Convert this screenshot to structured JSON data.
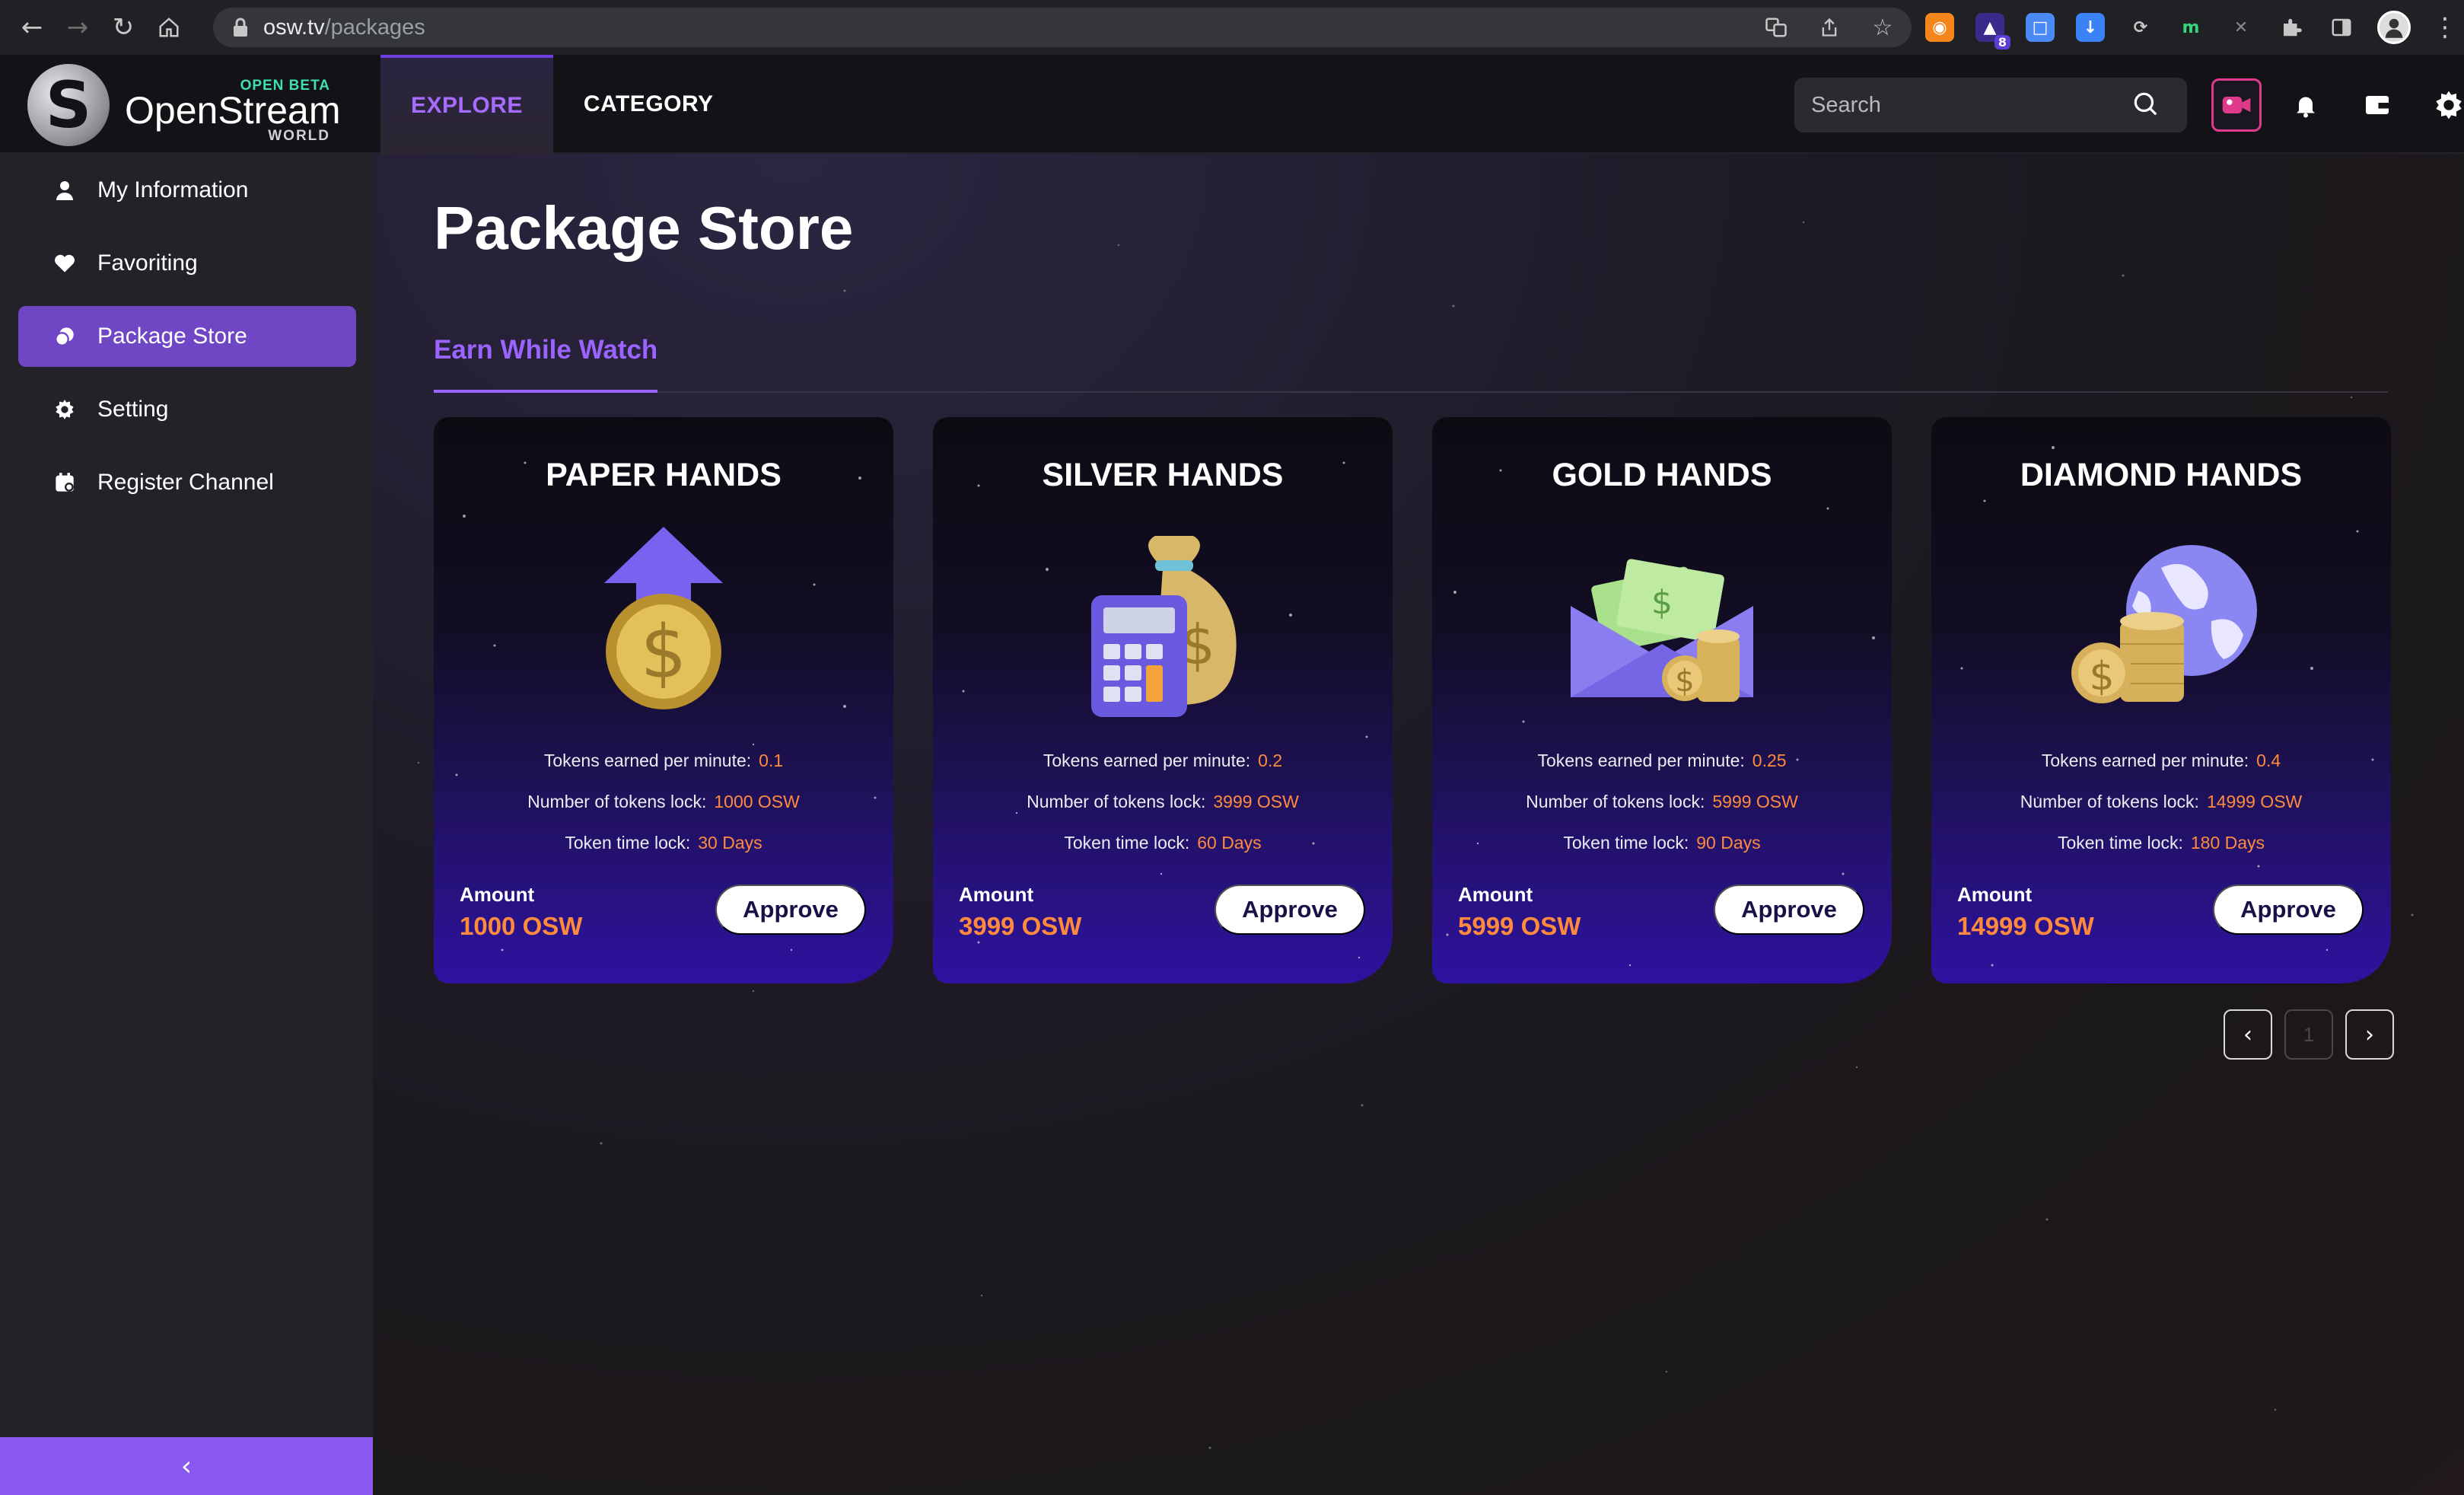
{
  "browser": {
    "url_host": "osw.tv",
    "url_path": "/packages",
    "extension_badge": "8"
  },
  "header": {
    "logo_badge": "OPEN BETA",
    "logo_name": "OpenStream",
    "logo_sub": "WORLD",
    "tabs": [
      {
        "label": "EXPLORE",
        "active": true
      },
      {
        "label": "CATEGORY",
        "active": false
      }
    ],
    "search_placeholder": "Search"
  },
  "sidebar": {
    "items": [
      {
        "label": "My Information",
        "icon": "user-icon",
        "active": false
      },
      {
        "label": "Favoriting",
        "icon": "heart-icon",
        "active": false
      },
      {
        "label": "Package Store",
        "icon": "package-icon",
        "active": true
      },
      {
        "label": "Setting",
        "icon": "gear-icon",
        "active": false
      },
      {
        "label": "Register Channel",
        "icon": "calendar-icon",
        "active": false
      }
    ],
    "collapse_icon": "chevron-left-icon"
  },
  "main": {
    "title": "Package Store",
    "tab": "Earn While Watch",
    "stat_labels": {
      "tokens_per_minute": "Tokens earned per minute:",
      "tokens_lock": "Number of tokens lock:",
      "time_lock": "Token time lock:"
    },
    "amount_label": "Amount",
    "approve_label": "Approve",
    "packages": [
      {
        "name": "PAPER HANDS",
        "rate": "0.1",
        "lock": "1000 OSW",
        "time": "30 Days",
        "amount": "1000 OSW",
        "icon": "dollar-coin-arrow-icon"
      },
      {
        "name": "SILVER HANDS",
        "rate": "0.2",
        "lock": "3999 OSW",
        "time": "60 Days",
        "amount": "3999 OSW",
        "icon": "calculator-money-bag-icon"
      },
      {
        "name": "GOLD HANDS",
        "rate": "0.25",
        "lock": "5999 OSW",
        "time": "90 Days",
        "amount": "5999 OSW",
        "icon": "envelope-cash-icon"
      },
      {
        "name": "DIAMOND HANDS",
        "rate": "0.4",
        "lock": "14999 OSW",
        "time": "180 Days",
        "amount": "14999 OSW",
        "icon": "globe-coins-icon"
      }
    ],
    "pagination": {
      "current": "1"
    }
  },
  "colors": {
    "accent": "#9b63ff",
    "sidebar_active": "#6f47c4",
    "value_orange": "#ff8a3d",
    "live_pink": "#e03a8c"
  }
}
